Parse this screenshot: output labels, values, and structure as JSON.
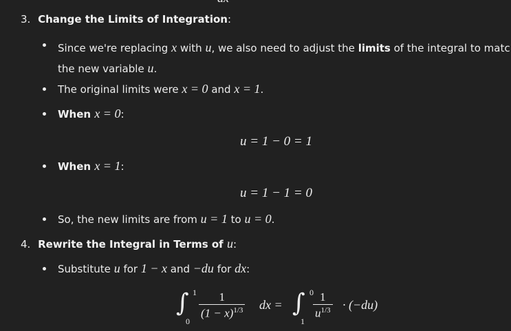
{
  "top_fragment": "dx",
  "step3": {
    "number": "3.",
    "title": "Change the Limits of Integration",
    "colon": ":",
    "b1_pre": "Since we're replacing ",
    "b1_x": "x",
    "b1_mid": " with ",
    "b1_u": "u",
    "b1_mid2": ", we also need to adjust the ",
    "b1_bold": "limits",
    "b1_post": " of the integral to match",
    "b1_line2": "the new variable ",
    "b1_line2_u": "u",
    "b1_line2_end": ".",
    "b2_pre": "The original limits were ",
    "b2_eq1": "x = 0",
    "b2_and": " and ",
    "b2_eq2": "x = 1",
    "b2_end": ".",
    "b3_when": "When ",
    "b3_eq": "x = 0",
    "b3_colon": ":",
    "eq1": "u = 1 − 0 = 1",
    "b4_when": "When ",
    "b4_eq": "x = 1",
    "b4_colon": ":",
    "eq2": "u = 1 − 1 = 0",
    "b5_pre": "So, the new limits are from ",
    "b5_eq1": "u = 1",
    "b5_to": " to ",
    "b5_eq2": "u = 0",
    "b5_end": "."
  },
  "step4": {
    "number": "4.",
    "title": "Rewrite the Integral in Terms of ",
    "title_u": "u",
    "colon": ":",
    "b1_pre": "Substitute ",
    "b1_u": "u",
    "b1_for": " for ",
    "b1_expr": "1 − x",
    "b1_and": " and ",
    "b1_du": "−du",
    "b1_for2": " for ",
    "b1_dx": "dx",
    "b1_end": ":",
    "integral": {
      "lhs_upper": "1",
      "lhs_lower": "0",
      "lhs_num": "1",
      "lhs_den": "(1 − x)",
      "lhs_den_exp": "1/3",
      "lhs_dx": "dx =",
      "rhs_upper": "0",
      "rhs_lower": "1",
      "rhs_num": "1",
      "rhs_den": "u",
      "rhs_den_exp": "1/3",
      "rhs_tail": "· (−du)"
    }
  }
}
